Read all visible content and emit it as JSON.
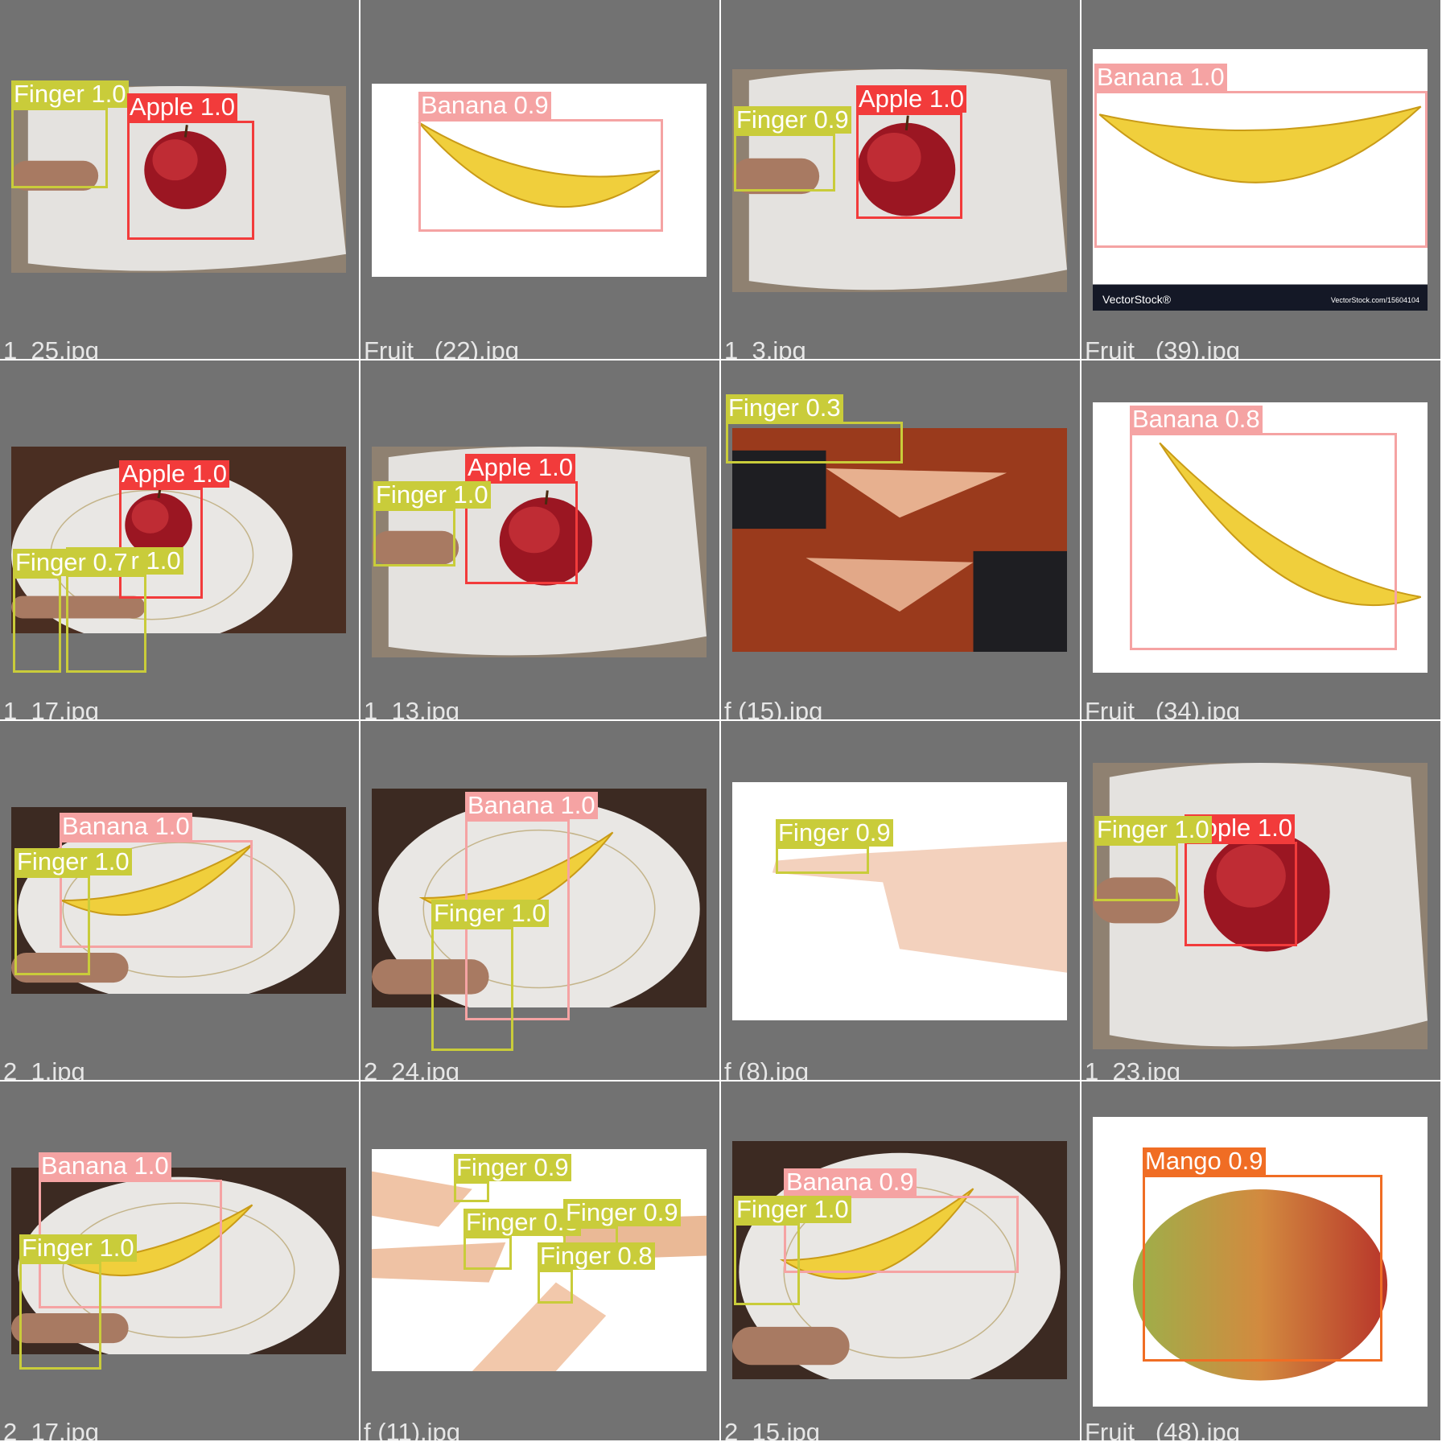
{
  "grid": {
    "background": "#ffffff",
    "tile_background": "#727272",
    "class_colors": {
      "Apple": "#f23b3b",
      "Banana": "#f5a3a3",
      "Finger": "#c9cc3a",
      "Mango": "#f06d24"
    },
    "tiles": [
      {
        "filename": "1_25.jpg",
        "scene": "apple-on-plate",
        "detections": [
          {
            "label": "Finger 1.0",
            "class": "Finger"
          },
          {
            "label": "Apple 1.0",
            "class": "Apple"
          }
        ]
      },
      {
        "filename": "Fruit_ (22).jpg",
        "scene": "banana-on-white",
        "detections": [
          {
            "label": "Banana 0.9",
            "class": "Banana"
          }
        ]
      },
      {
        "filename": "1_3.jpg",
        "scene": "apple-on-plate",
        "detections": [
          {
            "label": "Apple 1.0",
            "class": "Apple"
          },
          {
            "label": "Finger 0.9",
            "class": "Finger"
          }
        ]
      },
      {
        "filename": "Fruit_ (39).jpg",
        "scene": "banana-stock-image",
        "watermark_left": "VectorStock®",
        "watermark_right": "VectorStock.com/15604104",
        "detections": [
          {
            "label": "Banana 1.0",
            "class": "Banana"
          }
        ]
      },
      {
        "filename": "1_17.jpg",
        "scene": "apple-on-dinner-plate",
        "detections": [
          {
            "label": "Apple 1.0",
            "class": "Apple"
          },
          {
            "label": "Finger 1.0",
            "class": "Finger"
          },
          {
            "label": "Finger 0.7",
            "class": "Finger"
          }
        ]
      },
      {
        "filename": "1_13.jpg",
        "scene": "apple-on-plate",
        "detections": [
          {
            "label": "Apple 1.0",
            "class": "Apple"
          },
          {
            "label": "Finger 1.0",
            "class": "Finger"
          }
        ]
      },
      {
        "filename": "f (15).jpg",
        "scene": "two-hands-pointing",
        "detections": [
          {
            "label": "Finger 0.3",
            "class": "Finger"
          }
        ]
      },
      {
        "filename": "Fruit_ (34).jpg",
        "scene": "banana-upright",
        "detections": [
          {
            "label": "Banana 0.8",
            "class": "Banana"
          }
        ]
      },
      {
        "filename": "2_1.jpg",
        "scene": "banana-on-dinner-plate",
        "detections": [
          {
            "label": "Banana 1.0",
            "class": "Banana"
          },
          {
            "label": "Finger 1.0",
            "class": "Finger"
          }
        ]
      },
      {
        "filename": "2_24.jpg",
        "scene": "banana-on-dinner-plate",
        "detections": [
          {
            "label": "Banana 1.0",
            "class": "Banana"
          },
          {
            "label": "Finger 1.0",
            "class": "Finger"
          }
        ]
      },
      {
        "filename": "f (8).jpg",
        "scene": "hand-pointing-white",
        "detections": [
          {
            "label": "Finger 0.9",
            "class": "Finger"
          }
        ]
      },
      {
        "filename": "1_23.jpg",
        "scene": "apple-on-plate",
        "detections": [
          {
            "label": "Apple 1.0",
            "class": "Apple"
          },
          {
            "label": "Finger 1.0",
            "class": "Finger"
          }
        ]
      },
      {
        "filename": "2_17.jpg",
        "scene": "banana-on-dinner-plate",
        "detections": [
          {
            "label": "Banana 1.0",
            "class": "Banana"
          },
          {
            "label": "Finger 1.0",
            "class": "Finger"
          }
        ]
      },
      {
        "filename": "f (11).jpg",
        "scene": "many-hands-pointing",
        "detections": [
          {
            "label": "Finger 0.9",
            "class": "Finger"
          },
          {
            "label": "Finger 0.8",
            "class": "Finger"
          },
          {
            "label": "Finger 0.9",
            "class": "Finger"
          },
          {
            "label": "Finger 0.8",
            "class": "Finger"
          }
        ]
      },
      {
        "filename": "2_15.jpg",
        "scene": "banana-on-dinner-plate",
        "detections": [
          {
            "label": "Banana 0.9",
            "class": "Banana"
          },
          {
            "label": "Finger 1.0",
            "class": "Finger"
          }
        ]
      },
      {
        "filename": "Fruit_ (48).jpg",
        "scene": "mango-on-white",
        "detections": [
          {
            "label": "Mango 0.9",
            "class": "Mango"
          }
        ]
      }
    ]
  }
}
